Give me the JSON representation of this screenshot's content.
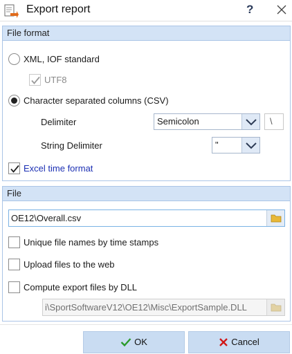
{
  "window": {
    "title": "Export report",
    "help": "?"
  },
  "file_format": {
    "header": "File format",
    "xml_label": "XML, IOF standard",
    "utf8_label": "UTF8",
    "csv_label": "Character separated columns (CSV)",
    "delimiter_label": "Delimiter",
    "delimiter_value": "Semicolon",
    "delimiter_char": "\\",
    "string_delimiter_label": "String Delimiter",
    "string_delimiter_value": "\"",
    "excel_label": "Excel time format",
    "selected": "csv",
    "utf8_checked": true,
    "excel_checked": true
  },
  "file": {
    "header": "File",
    "path_value": "OE12\\Overall.csv",
    "unique_label": "Unique file names by time stamps",
    "upload_label": "Upload files to the web",
    "dll_label": "Compute export files by DLL",
    "dll_path": "i\\SportSoftwareV12\\OE12\\Misc\\ExportSample.DLL",
    "unique_checked": false,
    "upload_checked": false,
    "dll_checked": false
  },
  "footer": {
    "ok_label": "OK",
    "cancel_label": "Cancel"
  },
  "colors": {
    "accent": "#d3e3f6",
    "button": "#c9dcf2",
    "link_blue": "#1b2fb3",
    "ok_check": "#2a9a2a",
    "cancel_x": "#d01818"
  }
}
